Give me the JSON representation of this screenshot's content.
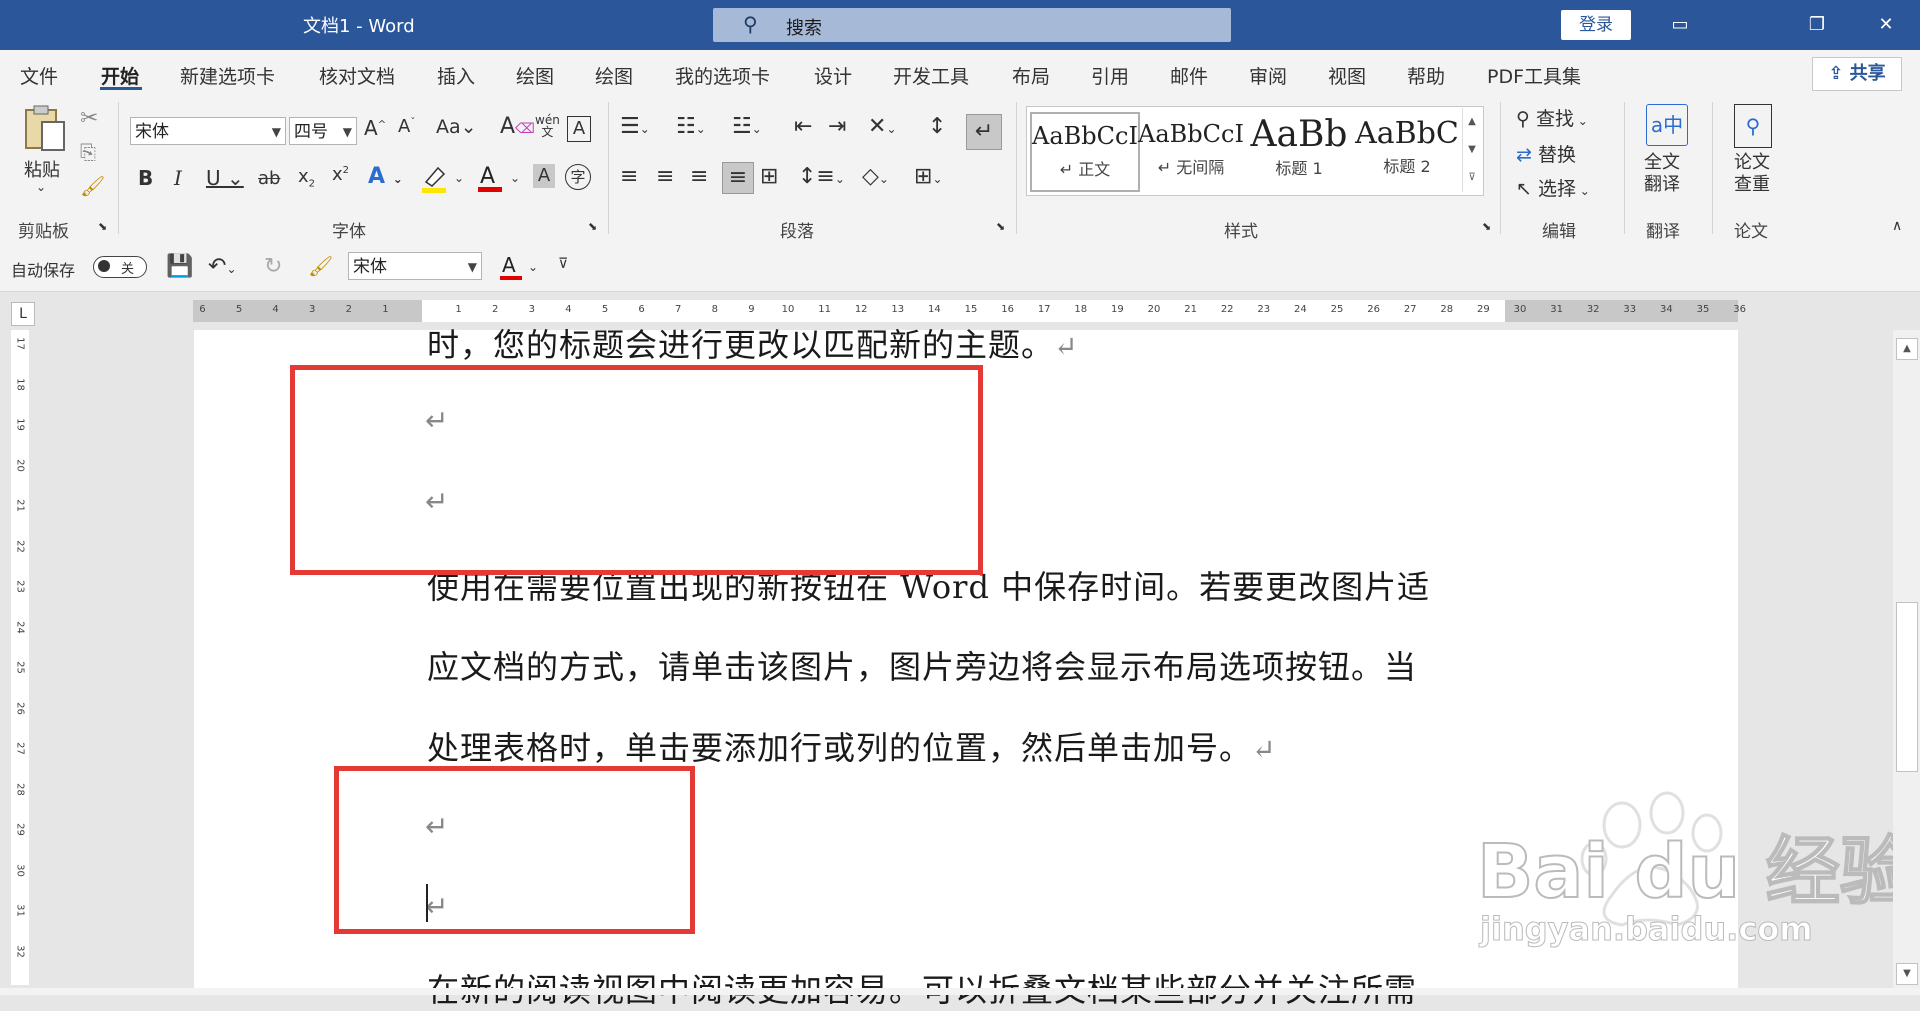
{
  "window": {
    "title": "文档1  -  Word",
    "search_placeholder": "搜索",
    "login_label": "登录",
    "icons": {
      "minimize": "▭",
      "restore": "❐",
      "close": "✕"
    }
  },
  "tabs": [
    "文件",
    "开始",
    "新建选项卡",
    "核对文档",
    "插入",
    "绘图",
    "绘图",
    "我的选项卡",
    "设计",
    "开发工具",
    "布局",
    "引用",
    "邮件",
    "审阅",
    "视图",
    "帮助",
    "PDF工具集"
  ],
  "active_tab": "开始",
  "share_label": "共享",
  "ribbon": {
    "clipboard": {
      "paste_label": "粘贴",
      "group_label": "剪贴板"
    },
    "font": {
      "font_name": "宋体",
      "font_size": "四号",
      "group_label": "字体"
    },
    "paragraph": {
      "group_label": "段落"
    },
    "styles": {
      "group_label": "样式",
      "items": [
        {
          "preview": "AaBbCcI",
          "name": "↵ 正文"
        },
        {
          "preview": "AaBbCcI",
          "name": "↵ 无间隔"
        },
        {
          "preview": "AaBb",
          "name": "标题 1"
        },
        {
          "preview": "AaBbC",
          "name": "标题 2"
        }
      ]
    },
    "editing": {
      "find": "查找",
      "replace": "替换",
      "select": "选择",
      "group_label": "编辑"
    },
    "translate": {
      "button": "全文\n翻译",
      "group_label": "翻译"
    },
    "paper": {
      "button": "论文\n查重",
      "group_label": "论文"
    }
  },
  "qat": {
    "autosave_label": "自动保存",
    "autosave_state": "关",
    "font_name": "宋体"
  },
  "ruler": {
    "h_left": [
      "6",
      "5",
      "4",
      "3",
      "2",
      "1"
    ],
    "h_right": [
      "1",
      "2",
      "3",
      "4",
      "5",
      "6",
      "7",
      "8",
      "9",
      "10",
      "11",
      "12",
      "13",
      "14",
      "15",
      "16",
      "17",
      "18",
      "19",
      "20",
      "21",
      "22",
      "23",
      "24",
      "25",
      "26",
      "27",
      "28",
      "29",
      "30",
      "31",
      "32",
      "33",
      "34",
      "35",
      "36"
    ],
    "v": [
      "17",
      "18",
      "19",
      "20",
      "21",
      "22",
      "23",
      "24",
      "25",
      "26",
      "27",
      "28",
      "29",
      "30",
      "31",
      "32"
    ]
  },
  "document": {
    "line0": "时，您的标题会进行更改以匹配新的主题。",
    "line1": "使用在需要位置出现的新按钮在 Word 中保存时间。若要更改图片适",
    "line2": "应文档的方式，请单击该图片，图片旁边将会显示布局选项按钮。当",
    "line3": "处理表格时，单击要添加行或列的位置，然后单击加号。",
    "line4": "在新的阅读视图中阅读更加容易。可以折叠文档某些部分并关注所需",
    "para_mark": "↵"
  },
  "watermark": {
    "brand": "Bai du 经验",
    "url": "jingyan.baidu.com"
  },
  "colors": {
    "word_blue": "#2b579a",
    "highlight_red": "#e53935"
  }
}
